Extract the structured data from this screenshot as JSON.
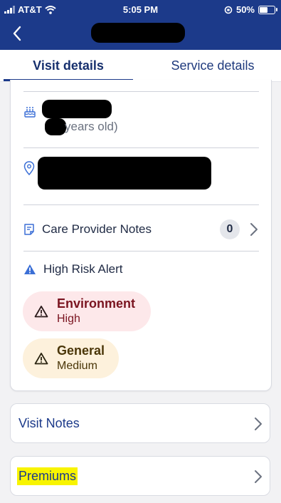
{
  "status_bar": {
    "carrier": "AT&T",
    "time": "5:05 PM",
    "battery": "50%"
  },
  "header": {
    "back_label": "Back"
  },
  "tabs": [
    {
      "label": "Visit details",
      "active": true
    },
    {
      "label": "Service details",
      "active": false
    }
  ],
  "client": {
    "age_suffix": "years old)"
  },
  "care_notes": {
    "label": "Care Provider Notes",
    "count": "0"
  },
  "risk": {
    "title": "High Risk Alert",
    "alerts": [
      {
        "category": "Environment",
        "level": "High",
        "color": "#7a1420",
        "bg": "#fde8ea"
      },
      {
        "category": "General",
        "level": "Medium",
        "color": "#4a3608",
        "bg": "#fdf1dc"
      }
    ]
  },
  "links": [
    {
      "label": "Visit Notes"
    },
    {
      "label": "Premiums"
    }
  ],
  "colors": {
    "brand": "#1c3a8a",
    "highlight": "#f8f400"
  }
}
